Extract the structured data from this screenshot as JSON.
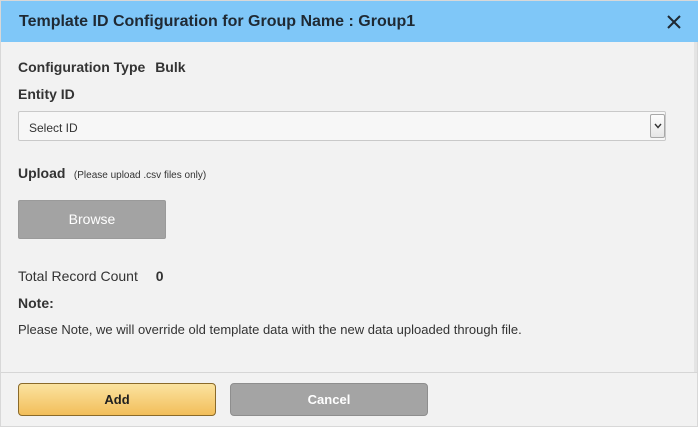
{
  "dialog": {
    "title": "Template ID Configuration for Group Name : Group1",
    "close_icon": "close-icon",
    "header_color": "#7fc7f8"
  },
  "config": {
    "type_label": "Configuration Type",
    "type_value": "Bulk"
  },
  "entity": {
    "label": "Entity ID",
    "select_value": "Select ID",
    "arrow_icon": "chevron-down-icon"
  },
  "upload": {
    "label": "Upload",
    "hint": "(Please upload .csv files only)",
    "browse_label": "Browse"
  },
  "records": {
    "label": "Total Record Count",
    "value": "0"
  },
  "note": {
    "label": "Note:",
    "text": "Please Note, we will override old template data with the new data uploaded through file."
  },
  "footer": {
    "add_label": "Add",
    "cancel_label": "Cancel",
    "add_color": "#f2be5a",
    "cancel_color": "#a4a4a4"
  }
}
